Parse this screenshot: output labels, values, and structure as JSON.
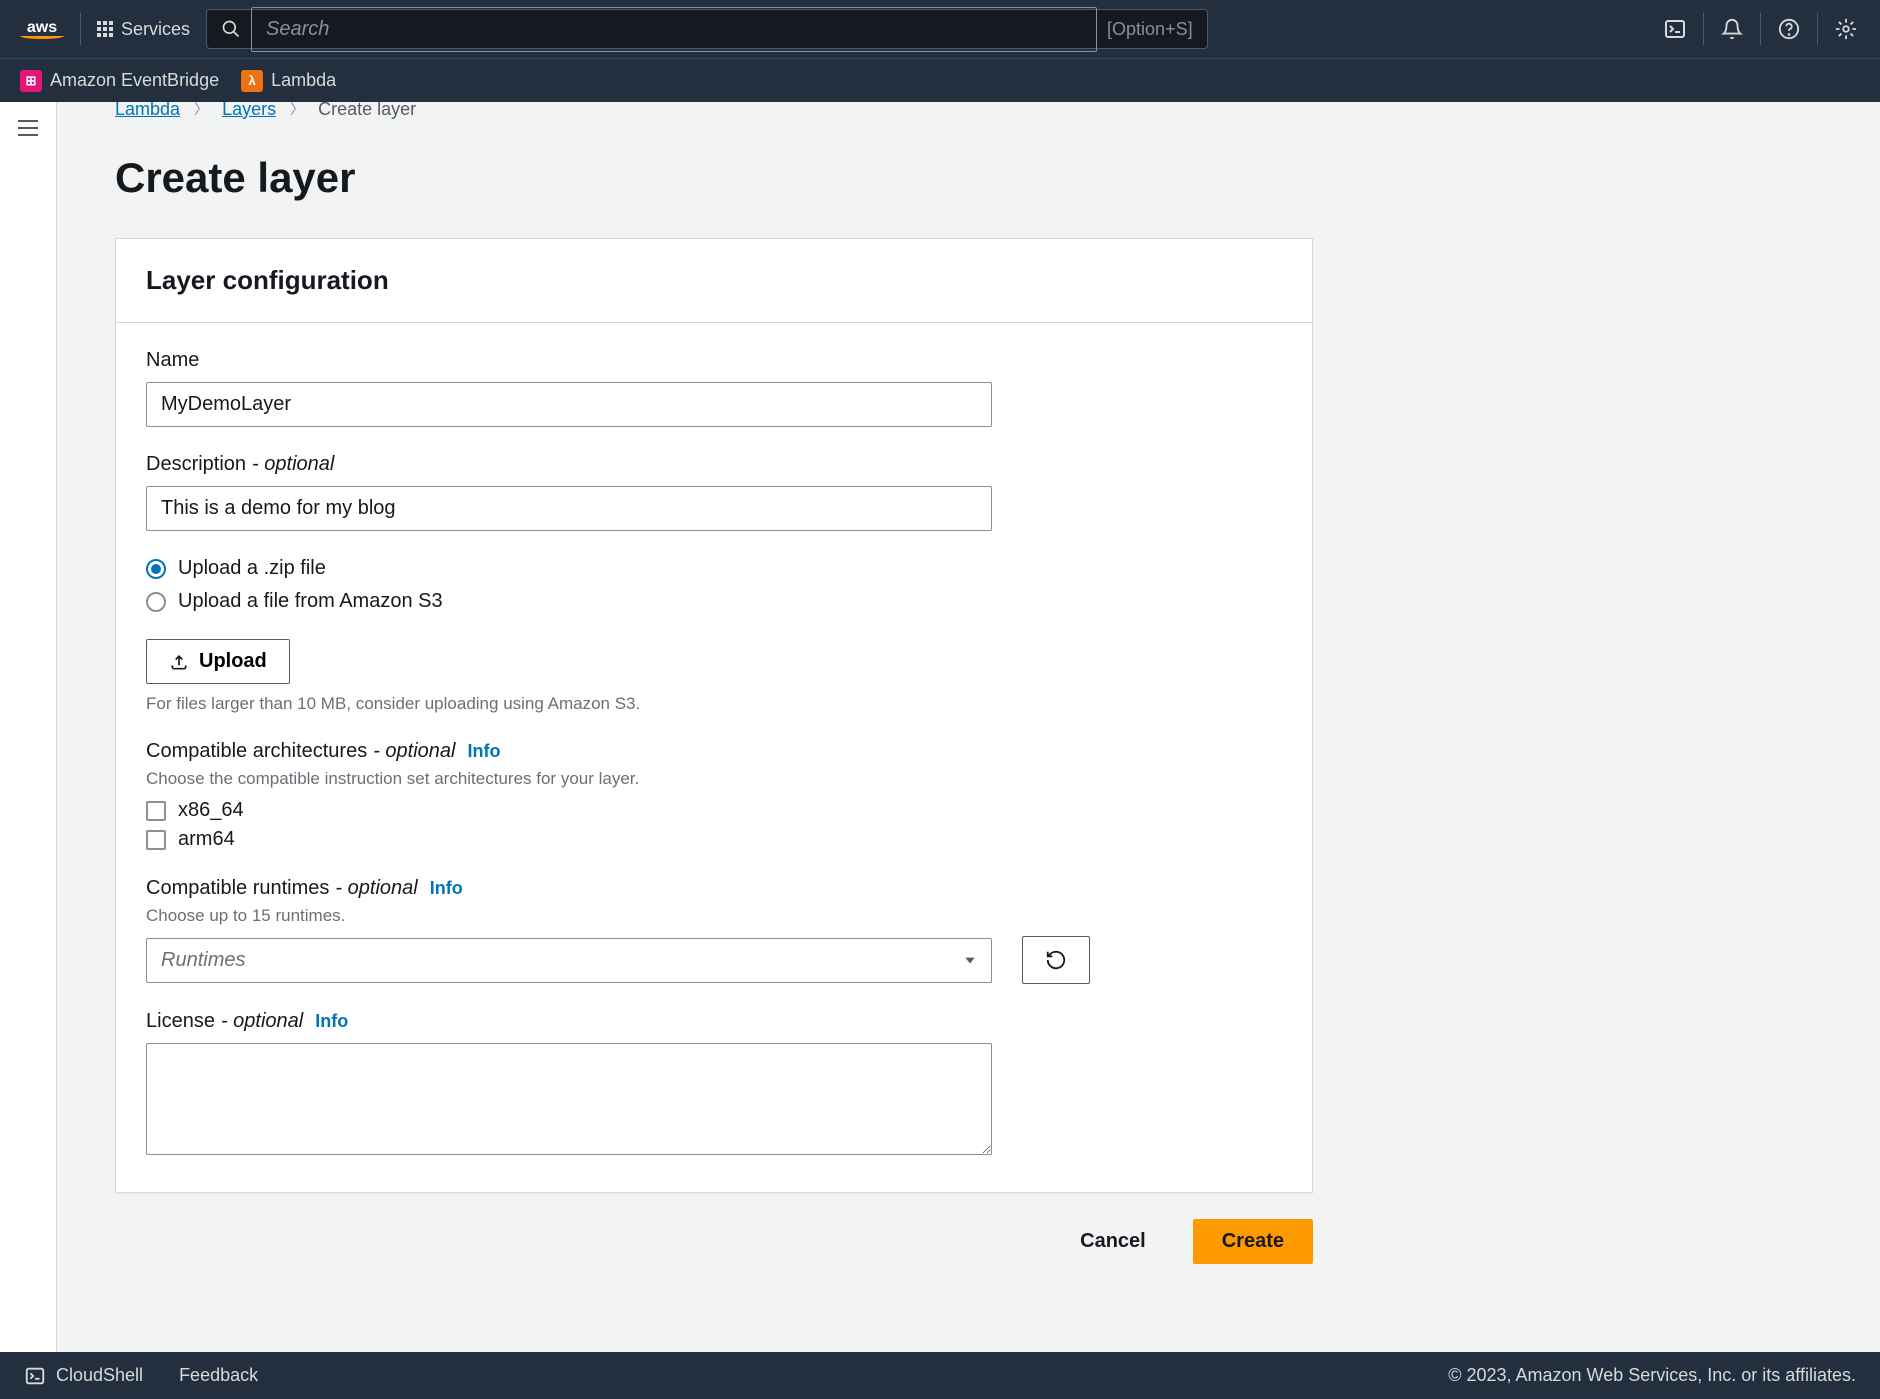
{
  "nav": {
    "logo_text": "aws",
    "services_label": "Services",
    "search_placeholder": "Search",
    "search_hint": "[Option+S]"
  },
  "favorites": [
    {
      "label": "Amazon EventBridge",
      "color": "pink",
      "glyph": "⊞"
    },
    {
      "label": "Lambda",
      "color": "orange",
      "glyph": "λ"
    }
  ],
  "breadcrumb": {
    "items": [
      "Lambda",
      "Layers",
      "Create layer"
    ]
  },
  "page": {
    "title": "Create layer",
    "panel_title": "Layer configuration"
  },
  "form": {
    "name": {
      "label": "Name",
      "value": "MyDemoLayer"
    },
    "description": {
      "label": "Description",
      "optional_text": " - optional",
      "value": "This is a demo for my blog"
    },
    "upload_options": [
      {
        "label": "Upload a .zip file",
        "checked": true
      },
      {
        "label": "Upload a file from Amazon S3",
        "checked": false
      }
    ],
    "upload_button": "Upload",
    "upload_hint": "For files larger than 10 MB, consider uploading using Amazon S3.",
    "arch": {
      "label": "Compatible architectures",
      "optional_text": " - optional",
      "info": "Info",
      "desc": "Choose the compatible instruction set architectures for your layer.",
      "options": [
        "x86_64",
        "arm64"
      ]
    },
    "runtimes": {
      "label": "Compatible runtimes",
      "optional_text": " - optional",
      "info": "Info",
      "desc": "Choose up to 15 runtimes.",
      "placeholder": "Runtimes"
    },
    "license": {
      "label": "License",
      "optional_text": " - optional",
      "info": "Info",
      "value": ""
    },
    "cancel": "Cancel",
    "create": "Create"
  },
  "footer": {
    "cloudshell": "CloudShell",
    "feedback": "Feedback",
    "copyright": "© 2023, Amazon Web Services, Inc. or its affiliates."
  }
}
